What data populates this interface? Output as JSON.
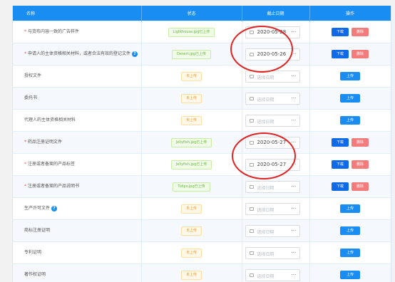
{
  "headers": {
    "name": "名称",
    "status": "状态",
    "deadline": "截止日期",
    "ops": "操作"
  },
  "buttons": {
    "download": "下载",
    "delete": "删除",
    "upload": "上传"
  },
  "rows": [
    {
      "required": true,
      "name": "与货布内容一致的广告样件",
      "help": false,
      "status": "Lighthouse.jpg已上传",
      "uploaded": true,
      "date": "2020-05-28",
      "actions": "download-delete"
    },
    {
      "required": true,
      "name": "申请人的主体资格相关材料，或者合法有效的登记文件",
      "help": true,
      "status": "Desert.jpg已上传",
      "uploaded": true,
      "date": "2020-05-26",
      "actions": "download-delete"
    },
    {
      "required": false,
      "name": "授权文件",
      "help": false,
      "status": "未上传",
      "uploaded": false,
      "date": "",
      "actions": "upload"
    },
    {
      "required": false,
      "name": "委托书",
      "help": false,
      "status": "未上传",
      "uploaded": false,
      "date": "",
      "actions": "upload"
    },
    {
      "required": false,
      "name": "代理人的主体资格相关材料",
      "help": false,
      "status": "未上传",
      "uploaded": false,
      "date": "",
      "actions": "upload"
    },
    {
      "required": true,
      "name": "药品注册证明文件",
      "help": false,
      "status": "Jellyfish.jpg已上传",
      "uploaded": true,
      "date": "2020-05-27",
      "actions": "download-delete"
    },
    {
      "required": true,
      "name": "注册或者备案的产品标签",
      "help": false,
      "status": "Jellyfish.jpg已上传",
      "uploaded": true,
      "date": "2020-05-27",
      "actions": "download-delete"
    },
    {
      "required": true,
      "name": "注册或者备案的产品说明书",
      "help": false,
      "status": "Tulips.jpg已上传",
      "uploaded": true,
      "date": "",
      "actions": "download-delete"
    },
    {
      "required": false,
      "name": "生产许可文件",
      "help": true,
      "status": "未上传",
      "uploaded": false,
      "date": "",
      "actions": "upload"
    },
    {
      "required": false,
      "name": "商标注册证明",
      "help": false,
      "status": "未上传",
      "uploaded": false,
      "date": "",
      "actions": "upload"
    },
    {
      "required": false,
      "name": "专利证明",
      "help": false,
      "status": "未上传",
      "uploaded": false,
      "date": "",
      "actions": "upload"
    },
    {
      "required": false,
      "name": "著作权证明",
      "help": false,
      "status": "未上传",
      "uploaded": false,
      "date": "",
      "actions": "upload"
    }
  ],
  "date_placeholder": "选择日期",
  "date_more": "...",
  "help_glyph": "?",
  "colors": {
    "header_bg": "#1a8df2",
    "download": "#1069e6",
    "delete": "#f47b7b",
    "uploaded_tag": "#6ab93a",
    "pending_tag": "#ec9b27",
    "annotation": "#e02424"
  }
}
